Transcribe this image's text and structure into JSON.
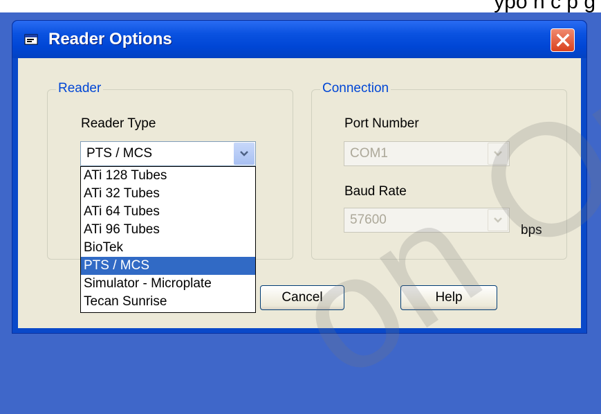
{
  "window": {
    "title": "Reader Options"
  },
  "reader_group": {
    "title": "Reader",
    "type_label": "Reader Type",
    "selected_value": "PTS / MCS",
    "options": [
      {
        "label": "ATi 128 Tubes",
        "selected": false
      },
      {
        "label": "ATi 32 Tubes",
        "selected": false
      },
      {
        "label": "ATi 64 Tubes",
        "selected": false
      },
      {
        "label": "ATi 96 Tubes",
        "selected": false
      },
      {
        "label": "BioTek",
        "selected": false
      },
      {
        "label": "PTS / MCS",
        "selected": true
      },
      {
        "label": "Simulator - Microplate",
        "selected": false
      },
      {
        "label": "Tecan Sunrise",
        "selected": false
      }
    ]
  },
  "connection_group": {
    "title": "Connection",
    "port_label": "Port Number",
    "port_value": "COM1",
    "baud_label": "Baud Rate",
    "baud_value": "57600",
    "baud_unit": "bps"
  },
  "buttons": {
    "cancel": "Cancel",
    "help": "Help"
  },
  "background_text": "ypo n c p g",
  "watermark": "on On",
  "colors": {
    "titlebar": "#0054e3",
    "selection": "#316ac5",
    "dialog": "#ece9d8",
    "close": "#e0512f"
  }
}
